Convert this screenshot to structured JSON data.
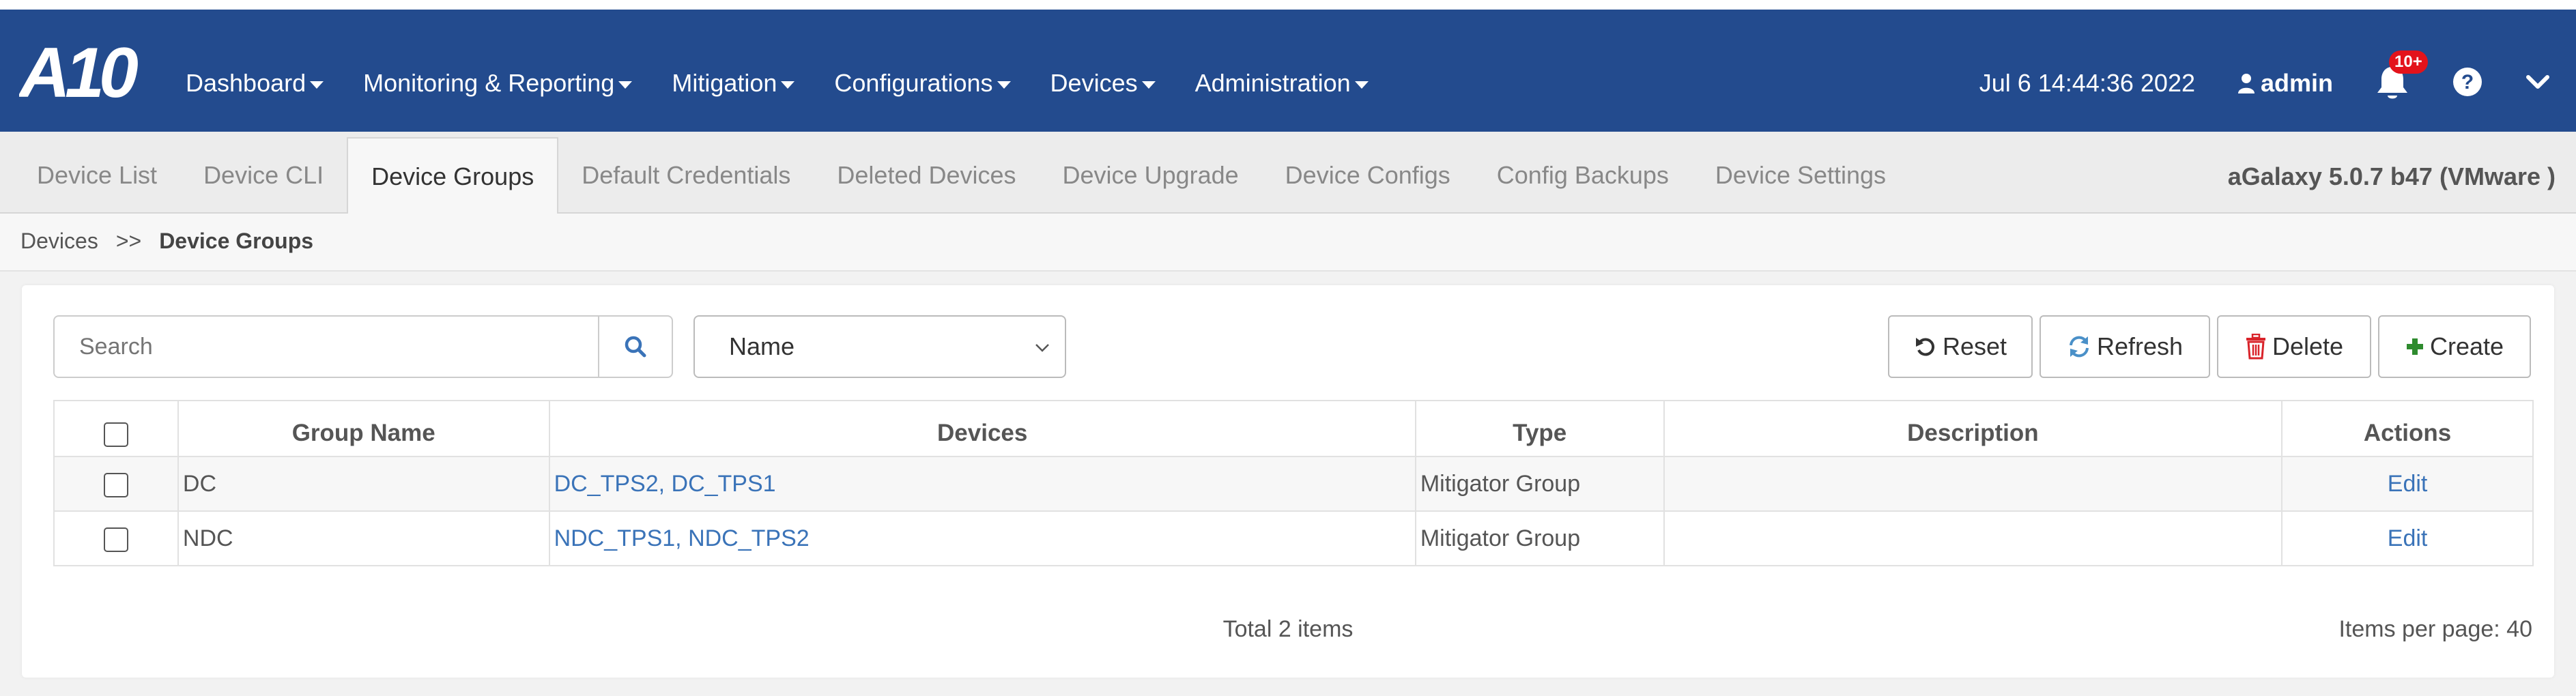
{
  "header": {
    "logo_text": "A10",
    "nav": [
      {
        "label": "Dashboard"
      },
      {
        "label": "Monitoring & Reporting"
      },
      {
        "label": "Mitigation"
      },
      {
        "label": "Configurations"
      },
      {
        "label": "Devices"
      },
      {
        "label": "Administration"
      }
    ],
    "datetime": "Jul 6 14:44:36 2022",
    "user": "admin",
    "notification_badge": "10+",
    "colors": {
      "nav_bg": "#234b8e",
      "badge": "#e3131b"
    }
  },
  "tabs": {
    "items": [
      {
        "label": "Device List"
      },
      {
        "label": "Device CLI"
      },
      {
        "label": "Device Groups"
      },
      {
        "label": "Default Credentials"
      },
      {
        "label": "Deleted Devices"
      },
      {
        "label": "Device Upgrade"
      },
      {
        "label": "Device Configs"
      },
      {
        "label": "Config Backups"
      },
      {
        "label": "Device Settings"
      }
    ],
    "active": "Device Groups",
    "version": "aGalaxy 5.0.7 b47 (VMware )"
  },
  "breadcrumb": {
    "parent": "Devices",
    "separator": ">>",
    "current": "Device Groups"
  },
  "toolbar": {
    "search_placeholder": "Search",
    "filter_selected": "Name",
    "reset_label": "Reset",
    "refresh_label": "Refresh",
    "delete_label": "Delete",
    "create_label": "Create"
  },
  "table": {
    "columns": [
      "Group Name",
      "Devices",
      "Type",
      "Description",
      "Actions"
    ],
    "rows": [
      {
        "group_name": "DC",
        "devices": "DC_TPS2, DC_TPS1",
        "type": "Mitigator Group",
        "description": "",
        "action": "Edit"
      },
      {
        "group_name": "NDC",
        "devices": "NDC_TPS1, NDC_TPS2",
        "type": "Mitigator Group",
        "description": "",
        "action": "Edit"
      }
    ]
  },
  "footer": {
    "total": "Total 2 items",
    "per_page": "Items per page: 40"
  }
}
